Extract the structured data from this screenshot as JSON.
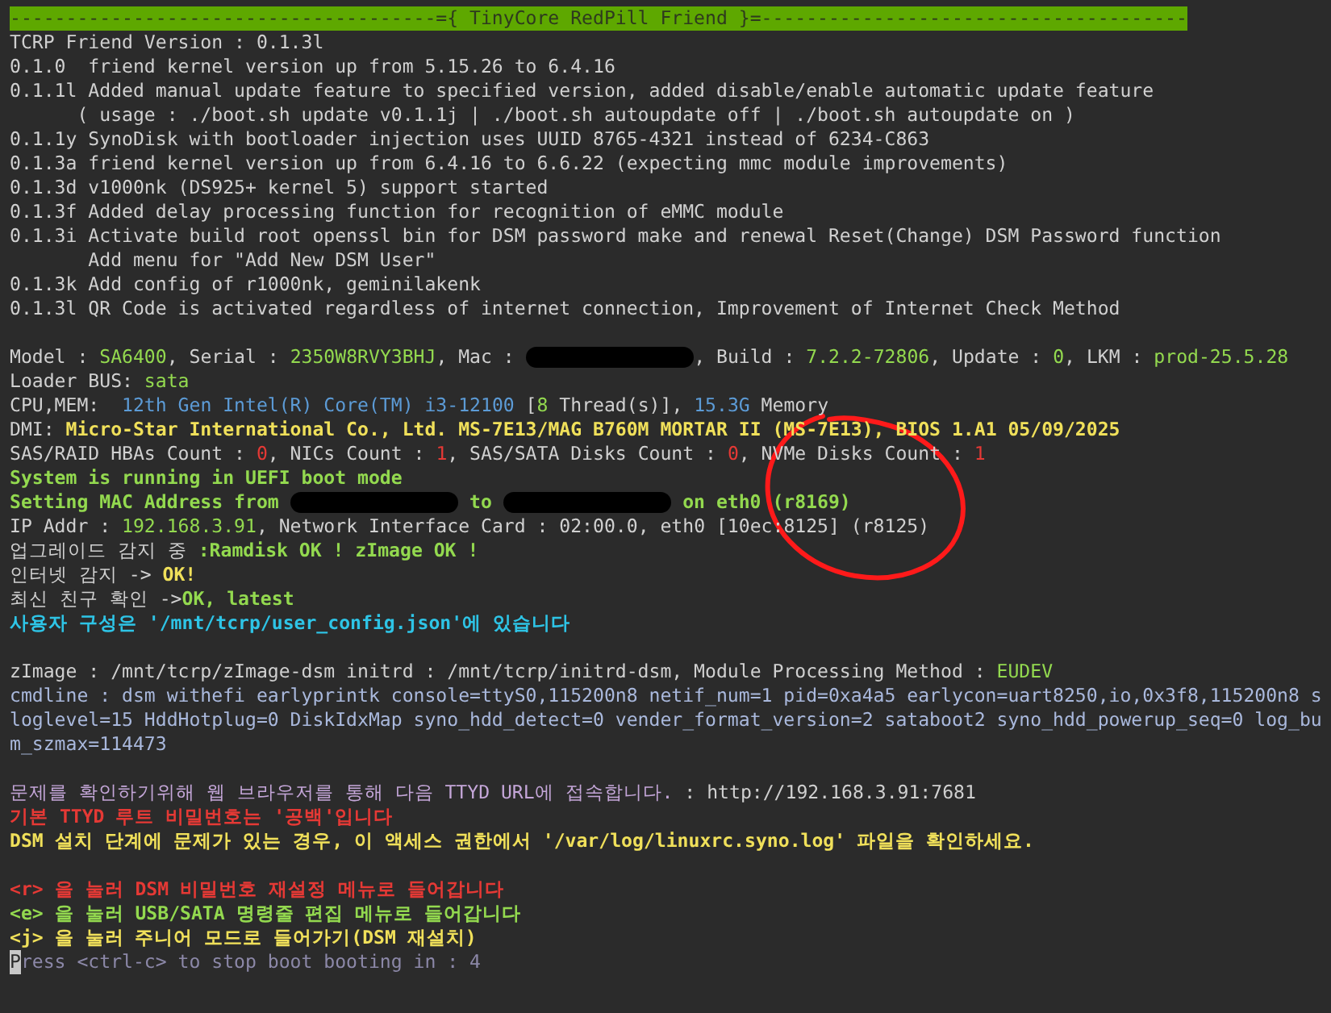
{
  "terminal": {
    "lines": [
      {
        "kind": "banner",
        "text": "--------------------------------------={ TinyCore RedPill Friend }=--------------------------------------"
      },
      {
        "kind": "text",
        "segments": [
          {
            "text": "TCRP Friend Version : 0.1.3l",
            "color": "#d0d0d0",
            "bold": false
          }
        ]
      },
      {
        "kind": "text",
        "segments": [
          {
            "text": "0.1.0  friend kernel version up from 5.15.26 to 6.4.16",
            "color": "#d0d0d0",
            "bold": false
          }
        ]
      },
      {
        "kind": "text",
        "segments": [
          {
            "text": "0.1.1l Added manual update feature to specified version, added disable/enable automatic update feature",
            "color": "#d0d0d0",
            "bold": false
          }
        ]
      },
      {
        "kind": "text",
        "segments": [
          {
            "text": "      ( usage : ./boot.sh update v0.1.1j | ./boot.sh autoupdate off | ./boot.sh autoupdate on )",
            "color": "#d0d0d0",
            "bold": false
          }
        ]
      },
      {
        "kind": "text",
        "segments": [
          {
            "text": "0.1.1y SynoDisk with bootloader injection uses UUID 8765-4321 instead of 6234-C863",
            "color": "#d0d0d0",
            "bold": false
          }
        ]
      },
      {
        "kind": "text",
        "segments": [
          {
            "text": "0.1.3a friend kernel version up from 6.4.16 to 6.6.22 (expecting mmc module improvements)",
            "color": "#d0d0d0",
            "bold": false
          }
        ]
      },
      {
        "kind": "text",
        "segments": [
          {
            "text": "0.1.3d v1000nk (DS925+ kernel 5) support started",
            "color": "#d0d0d0",
            "bold": false
          }
        ]
      },
      {
        "kind": "text",
        "segments": [
          {
            "text": "0.1.3f Added delay processing function for recognition of eMMC module",
            "color": "#d0d0d0",
            "bold": false
          }
        ]
      },
      {
        "kind": "text",
        "segments": [
          {
            "text": "0.1.3i Activate build root openssl bin for DSM password make and renewal Reset(Change) DSM Password function",
            "color": "#d0d0d0",
            "bold": false
          }
        ]
      },
      {
        "kind": "text",
        "segments": [
          {
            "text": "       Add menu for \"Add New DSM User\"",
            "color": "#d0d0d0",
            "bold": false
          }
        ]
      },
      {
        "kind": "text",
        "segments": [
          {
            "text": "0.1.3k Add config of r1000nk, geminilakenk",
            "color": "#d0d0d0",
            "bold": false
          }
        ]
      },
      {
        "kind": "text",
        "segments": [
          {
            "text": "0.1.3l QR Code is activated regardless of internet connection, Improvement of Internet Check Method",
            "color": "#d0d0d0",
            "bold": false
          }
        ]
      },
      {
        "kind": "blank"
      },
      {
        "kind": "text",
        "segments": [
          {
            "text": "Model : ",
            "color": "#d0d0d0",
            "bold": false
          },
          {
            "text": "SA6400",
            "color": "#93d94f",
            "bold": false
          },
          {
            "text": ", Serial : ",
            "color": "#d0d0d0",
            "bold": false
          },
          {
            "text": "2350W8RVY3BHJ",
            "color": "#93d94f",
            "bold": false
          },
          {
            "text": ", Mac : ",
            "color": "#d0d0d0",
            "bold": false
          },
          {
            "kind": "redacted"
          },
          {
            "text": ", Build : ",
            "color": "#d0d0d0",
            "bold": false
          },
          {
            "text": "7.2.2-72806",
            "color": "#93d94f",
            "bold": false
          },
          {
            "text": ", Update : ",
            "color": "#d0d0d0",
            "bold": false
          },
          {
            "text": "0",
            "color": "#93d94f",
            "bold": false
          },
          {
            "text": ", LKM : ",
            "color": "#d0d0d0",
            "bold": false
          },
          {
            "text": "prod-25.5.28",
            "color": "#93d94f",
            "bold": false
          }
        ]
      },
      {
        "kind": "text",
        "segments": [
          {
            "text": "Loader BUS: ",
            "color": "#d0d0d0",
            "bold": false
          },
          {
            "text": "sata",
            "color": "#93d94f",
            "bold": false
          }
        ]
      },
      {
        "kind": "text",
        "segments": [
          {
            "text": "CPU,MEM:  ",
            "color": "#d0d0d0",
            "bold": false
          },
          {
            "text": "12th Gen Intel(R) Core(TM) i3-12100",
            "color": "#5c9bd6",
            "bold": false
          },
          {
            "text": " [",
            "color": "#d0d0d0",
            "bold": false
          },
          {
            "text": "8",
            "color": "#93d94f",
            "bold": false
          },
          {
            "text": " Thread(s)], ",
            "color": "#d0d0d0",
            "bold": false
          },
          {
            "text": "15.3G",
            "color": "#5c9bd6",
            "bold": false
          },
          {
            "text": " Memory",
            "color": "#d0d0d0",
            "bold": false
          }
        ]
      },
      {
        "kind": "text",
        "segments": [
          {
            "text": "DMI: ",
            "color": "#d0d0d0",
            "bold": false
          },
          {
            "text": "Micro-Star International Co., Ltd. MS-7E13/MAG B760M MORTAR II (MS-7E13), BIOS 1.A1 05/09/2025",
            "color": "#f0e05a",
            "bold": true
          }
        ]
      },
      {
        "kind": "text",
        "segments": [
          {
            "text": "SAS/RAID HBAs Count : ",
            "color": "#d0d0d0",
            "bold": false
          },
          {
            "text": "0",
            "color": "#e53935",
            "bold": false
          },
          {
            "text": ", NICs Count : ",
            "color": "#d0d0d0",
            "bold": false
          },
          {
            "text": "1",
            "color": "#e53935",
            "bold": false
          },
          {
            "text": ", SAS/SATA Disks Count : ",
            "color": "#d0d0d0",
            "bold": false
          },
          {
            "text": "0",
            "color": "#e53935",
            "bold": false
          },
          {
            "text": ", NVMe Disks Count : ",
            "color": "#d0d0d0",
            "bold": false
          },
          {
            "text": "1",
            "color": "#e53935",
            "bold": false
          }
        ]
      },
      {
        "kind": "text",
        "segments": [
          {
            "text": "System is running in UEFI boot mode",
            "color": "#93d94f",
            "bold": true
          }
        ]
      },
      {
        "kind": "text",
        "segments": [
          {
            "text": "Setting MAC Address from ",
            "color": "#93d94f",
            "bold": true
          },
          {
            "kind": "redacted"
          },
          {
            "text": " to ",
            "color": "#93d94f",
            "bold": true
          },
          {
            "kind": "redacted"
          },
          {
            "text": " on eth0 (r8169)",
            "color": "#93d94f",
            "bold": true
          }
        ]
      },
      {
        "kind": "text",
        "segments": [
          {
            "text": "IP Addr : ",
            "color": "#d0d0d0",
            "bold": false
          },
          {
            "text": "192.168.3.91",
            "color": "#93d94f",
            "bold": false
          },
          {
            "text": ", Network Interface Card : 02:00.0, eth0 [10ec:8125] (r8125)",
            "color": "#d0d0d0",
            "bold": false
          }
        ]
      },
      {
        "kind": "text",
        "segments": [
          {
            "text": "업그레이드 감지 중 ",
            "color": "#d0d0d0",
            "bold": false
          },
          {
            "text": ":Ramdisk OK ! zImage OK !",
            "color": "#93d94f",
            "bold": true
          }
        ]
      },
      {
        "kind": "text",
        "segments": [
          {
            "text": "인터넷 감지 -> ",
            "color": "#d0d0d0",
            "bold": false
          },
          {
            "text": "OK!",
            "color": "#f0e05a",
            "bold": true
          }
        ]
      },
      {
        "kind": "text",
        "segments": [
          {
            "text": "최신 친구 확인 ->",
            "color": "#d0d0d0",
            "bold": false
          },
          {
            "text": "OK, latest",
            "color": "#93d94f",
            "bold": true
          }
        ]
      },
      {
        "kind": "text",
        "segments": [
          {
            "text": "사용자 구성은 '/mnt/tcrp/user_config.json'에 있습니다",
            "color": "#2ec4e6",
            "bold": true
          }
        ]
      },
      {
        "kind": "blank"
      },
      {
        "kind": "text",
        "segments": [
          {
            "text": "zImage : /mnt/tcrp/zImage-dsm initrd : /mnt/tcrp/initrd-dsm, Module Processing Method : ",
            "color": "#d0d0d0",
            "bold": false
          },
          {
            "text": "EUDEV",
            "color": "#93d94f",
            "bold": false
          }
        ]
      },
      {
        "kind": "text",
        "segments": [
          {
            "text": "cmdline : dsm withefi earlyprintk console=ttyS0,115200n8 netif_num=1 pid=0xa4a5 earlycon=uart8250,io,0x3f8,115200n8 s",
            "color": "#a9b8dc",
            "bold": false
          }
        ]
      },
      {
        "kind": "text",
        "segments": [
          {
            "text": "loglevel=15 HddHotplug=0 DiskIdxMap syno_hdd_detect=0 vender_format_version=2 sataboot2 syno_hdd_powerup_seq=0 log_bu",
            "color": "#a9b8dc",
            "bold": false
          }
        ]
      },
      {
        "kind": "text",
        "segments": [
          {
            "text": "m_szmax=114473",
            "color": "#a9b8dc",
            "bold": false
          }
        ]
      },
      {
        "kind": "blank"
      },
      {
        "kind": "text",
        "segments": [
          {
            "text": "문제를 확인하기위해 웹 브라우저를 통해 다음 TTYD URL에 접속합니다.",
            "color": "#c4a6d8",
            "bold": false
          },
          {
            "text": " : http://192.168.3.91:7681",
            "color": "#d0d0d0",
            "bold": false
          }
        ]
      },
      {
        "kind": "text",
        "segments": [
          {
            "text": "기본 TTYD 루트 비밀번호는 '공백'입니다",
            "color": "#e53935",
            "bold": true
          }
        ]
      },
      {
        "kind": "text",
        "segments": [
          {
            "text": "DSM 설치 단계에 문제가 있는 경우, 이 액세스 권한에서 '/var/log/linuxrc.syno.log' 파일을 확인하세요.",
            "color": "#f0e05a",
            "bold": true
          }
        ]
      },
      {
        "kind": "blank"
      },
      {
        "kind": "text",
        "segments": [
          {
            "text": "<r> 을 눌러 DSM 비밀번호 재설정 메뉴로 들어갑니다",
            "color": "#e53935",
            "bold": true
          }
        ]
      },
      {
        "kind": "text",
        "segments": [
          {
            "text": "<e> 을 눌러 USB/SATA 명령줄 편집 메뉴로 들어갑니다",
            "color": "#93d94f",
            "bold": true
          }
        ]
      },
      {
        "kind": "text",
        "segments": [
          {
            "text": "<j> 을 눌러 주니어 모드로 들어가기(DSM 재설치)",
            "color": "#f0e05a",
            "bold": true
          }
        ]
      },
      {
        "kind": "text",
        "segments": [
          {
            "kind": "cursor",
            "text": "P"
          },
          {
            "text": "ress <ctrl-c> to stop boot booting in : 4",
            "color": "#8c88a8",
            "bold": false
          }
        ]
      }
    ]
  }
}
